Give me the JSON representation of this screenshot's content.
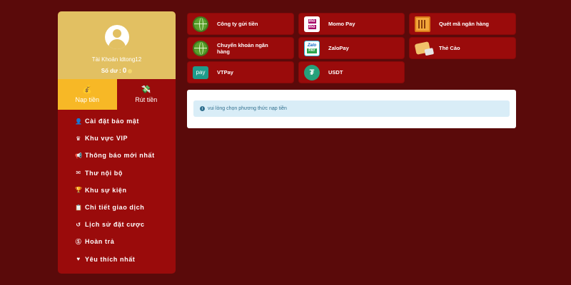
{
  "profile": {
    "account_label": "Tài Khoản ldtong12",
    "balance_label": "Số dư :",
    "balance_value": "0"
  },
  "tabs": [
    {
      "label": "Nạp tiền",
      "icon": "wallet-deposit-icon",
      "active": true
    },
    {
      "label": "Rút tiền",
      "icon": "hand-withdraw-icon",
      "active": false
    }
  ],
  "menu": [
    {
      "label": "Cài đặt bảo mật",
      "icon": "user-lock-icon"
    },
    {
      "label": "Khu vực VIP",
      "icon": "crown-icon"
    },
    {
      "label": "Thông báo mới nhất",
      "icon": "megaphone-icon"
    },
    {
      "label": "Thư nội bộ",
      "icon": "envelope-icon"
    },
    {
      "label": "Khu sự kiện",
      "icon": "trophy-icon"
    },
    {
      "label": "Chi tiết giao dịch",
      "icon": "clipboard-icon"
    },
    {
      "label": "Lịch sử đặt cược",
      "icon": "history-icon"
    },
    {
      "label": "Hoàn trả",
      "icon": "dollar-circle-icon"
    },
    {
      "label": "Yêu thích nhất",
      "icon": "heart-icon"
    }
  ],
  "payment_methods": [
    {
      "label": "Công ty gửi tiền",
      "icon": "globe-icon"
    },
    {
      "label": "Momo Pay",
      "icon": "momo-logo-icon"
    },
    {
      "label": "Quét mã ngân hàng",
      "icon": "qr-code-icon"
    },
    {
      "label": "Chuyển khoản ngân hàng",
      "icon": "globe-icon"
    },
    {
      "label": "ZaloPay",
      "icon": "zalopay-logo-icon"
    },
    {
      "label": "Thẻ Cào",
      "icon": "scratch-card-icon"
    },
    {
      "label": "VTPay",
      "icon": "vtpay-logo-icon"
    },
    {
      "label": "USDT",
      "icon": "tether-icon"
    }
  ],
  "notice": {
    "text": "vui lòng chọn phương thức nạp tiền",
    "icon": "info-icon"
  },
  "colors": {
    "background": "#5a0a0a",
    "panel": "#9a0b0b",
    "profile": "#e2c062",
    "active_tab": "#f7b826",
    "notice_bg": "#d9edf7",
    "notice_text": "#31708f"
  }
}
